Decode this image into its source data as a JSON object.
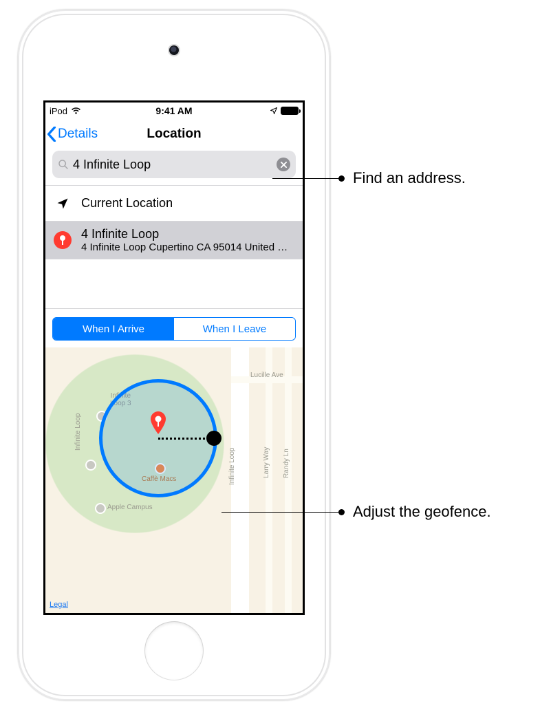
{
  "statusbar": {
    "carrier": "iPod",
    "time": "9:41 AM"
  },
  "nav": {
    "back": "Details",
    "title": "Location"
  },
  "search": {
    "value": "4 Infinite Loop"
  },
  "list": {
    "current": "Current Location",
    "result": {
      "title": "4 Infinite Loop",
      "subtitle": "4 Infinite Loop Cupertino CA 95014 United St…"
    }
  },
  "segment": {
    "arrive": "When I Arrive",
    "leave": "When I Leave"
  },
  "map": {
    "legal": "Legal",
    "labels": {
      "lucille": "Lucille Ave",
      "loop3": "Infinite\nLoop 3",
      "caffe": "Caffè Macs",
      "campus": "Apple Campus",
      "iloopL": "Infinite Loop",
      "iloopR": "Infinite Loop",
      "larry": "Larry Way",
      "randy": "Randy Ln"
    }
  },
  "callouts": {
    "search": "Find an address.",
    "geofence": "Adjust the geofence."
  }
}
